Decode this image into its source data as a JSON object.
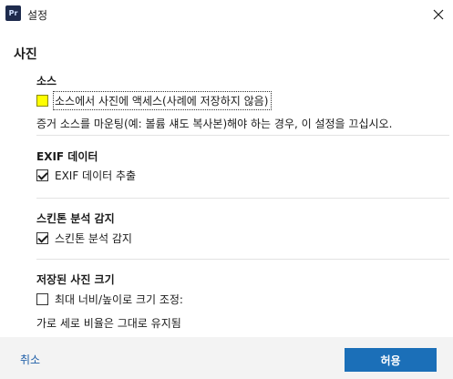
{
  "window": {
    "app_icon_text": "Pr",
    "title": "설정"
  },
  "section": {
    "title": "사진"
  },
  "source": {
    "heading": "소스",
    "checkbox_label": "소스에서 사진에 액세스(사례에 저장하지 않음)",
    "checked": false,
    "note": "증거 소스를 마운팅(예: 볼륨 섀도 복사본)해야 하는 경우, 이 설정을 끄십시오."
  },
  "exif": {
    "heading": "EXIF 데이터",
    "checkbox_label": "EXIF 데이터 추출",
    "checked": true
  },
  "skin_tone": {
    "heading": "스킨톤 분석 감지",
    "checkbox_label": "스킨톤 분석 감지",
    "checked": true
  },
  "saved_size": {
    "heading": "저장된 사진 크기",
    "checkbox_label": "최대 너비/높이로 크기 조정:",
    "checked": false,
    "note": "가로 세로 비율은 그대로 유지됨"
  },
  "footer": {
    "cancel_label": "취소",
    "ok_label": "허용"
  },
  "colors": {
    "accent": "#1b6fb8",
    "link": "#1f5fa8",
    "highlight": "#ffff00"
  }
}
